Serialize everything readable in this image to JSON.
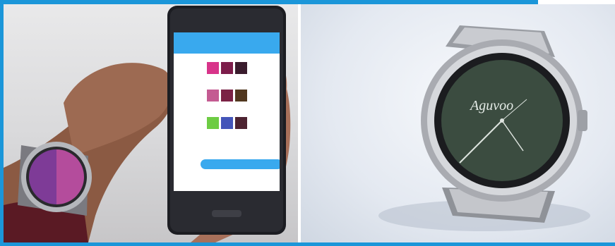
{
  "image": {
    "left_photo": {
      "watch_face_colors": [
        "#7e3b97",
        "#b44c9c"
      ],
      "phone_swatch_rows": [
        [
          "#d8348a",
          "#7d1d4b",
          "#3a1c2d"
        ],
        [
          "#c45b92",
          "#7b2245",
          "#51371f"
        ],
        [
          "#6dcc43",
          "#4455b9",
          "#4d2331"
        ]
      ],
      "phone_accent_color": "#39a9ee"
    },
    "right_photo": {
      "watch_face_text": "Aguvoo",
      "watch_face_color": "#3b4c40"
    }
  }
}
